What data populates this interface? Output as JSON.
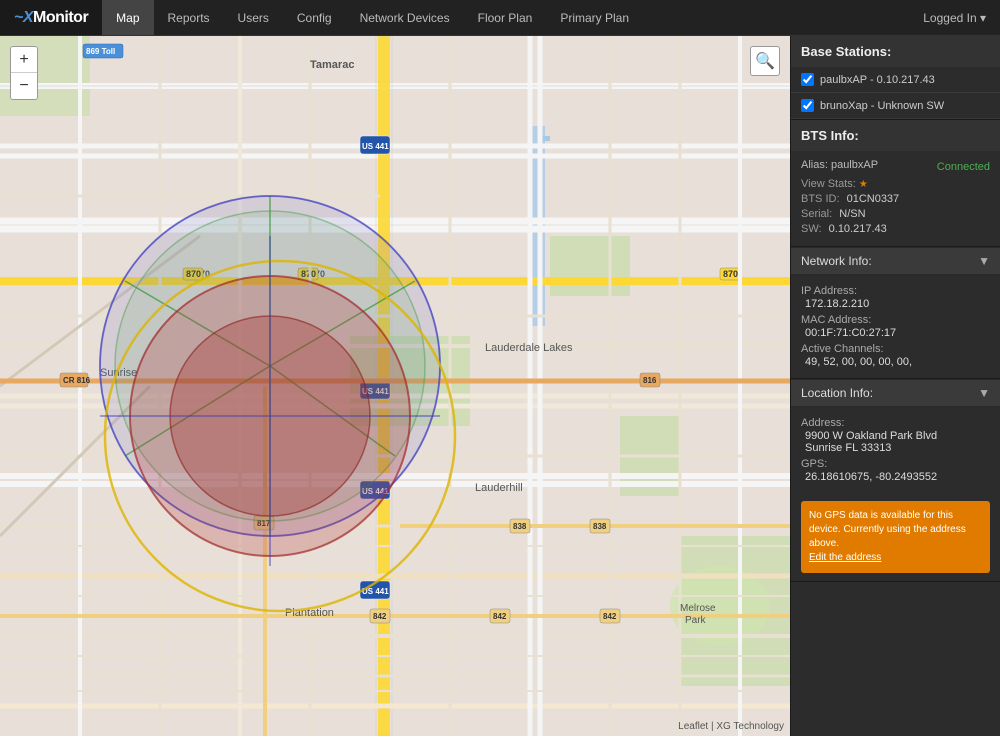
{
  "app": {
    "brand": "Monitor",
    "brand_prefix": "~X"
  },
  "navbar": {
    "items": [
      {
        "label": "Map",
        "active": true
      },
      {
        "label": "Reports",
        "active": false
      },
      {
        "label": "Users",
        "active": false
      },
      {
        "label": "Config",
        "active": false
      },
      {
        "label": "Network Devices",
        "active": false
      },
      {
        "label": "Floor Plan",
        "active": false
      },
      {
        "label": "Primary Plan",
        "active": false
      }
    ],
    "logged_in": "Logged In ▾"
  },
  "panel": {
    "base_stations_header": "Base Stations:",
    "stations": [
      {
        "label": "paulbxAP - 0.10.217.43",
        "checked": true
      },
      {
        "label": "brunoXap - Unknown SW",
        "checked": true
      }
    ],
    "bts_info_header": "BTS Info:",
    "alias_label": "Alias: paulbxAP",
    "view_stats": "View Stats:",
    "status": "Connected",
    "bts_id_label": "BTS ID:",
    "bts_id_value": "01CN0337",
    "serial_label": "Serial:",
    "serial_value": "N/SN",
    "sw_label": "SW:",
    "sw_value": "0.10.217.43",
    "network_info_header": "Network Info:",
    "ip_label": "IP Address:",
    "ip_value": "172.18.2.210",
    "mac_label": "MAC Address:",
    "mac_value": "00:1F:71:C0:27:17",
    "channels_label": "Active Channels:",
    "channels_value": "49, 52, 00, 00, 00, 00,",
    "location_info_header": "Location Info:",
    "address_label": "Address:",
    "address_value": "9900 W Oakland Park Blvd\nSunrise FL 33313",
    "gps_label": "GPS:",
    "gps_value": "26.18610675, -80.2493552",
    "warning_text": "No GPS data is available for this device. Currently using the address above.",
    "warning_link": "Edit the address"
  },
  "map": {
    "search_icon": "🔍",
    "zoom_in": "+",
    "zoom_out": "−",
    "attribution": "Leaflet | XG Technology"
  }
}
